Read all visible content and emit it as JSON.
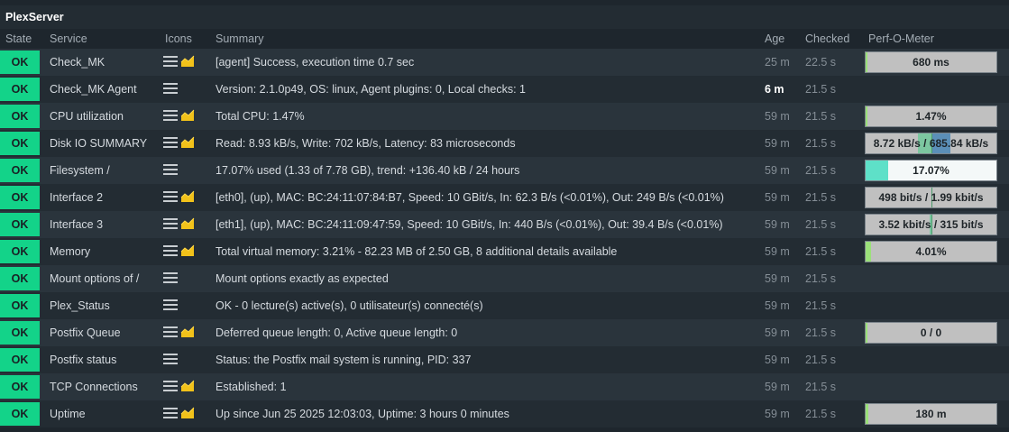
{
  "host": {
    "name": "PlexServer"
  },
  "columns": {
    "state": "State",
    "service": "Service",
    "icons": "Icons",
    "summary": "Summary",
    "age": "Age",
    "checked": "Checked",
    "perf": "Perf-O-Meter"
  },
  "colors": {
    "ok": "#13d389",
    "perf_green": "#9be07a",
    "perf_teal": "#5ee0c8",
    "perf_io_write": "#5b8fb8",
    "perf_io_read": "#7cc6a0"
  },
  "icons": {
    "menu": "hamburger-menu-icon",
    "graph": "graph-icon"
  },
  "rows": [
    {
      "state": "OK",
      "service": "Check_MK",
      "graph": true,
      "summary": "[agent] Success, execution time 0.7 sec",
      "age": "25 m",
      "age_recent": false,
      "checked": "22.5 s",
      "perf": {
        "label": "680 ms",
        "kind": "single",
        "level": 0.0
      }
    },
    {
      "state": "OK",
      "service": "Check_MK Agent",
      "graph": false,
      "summary": "Version: 2.1.0p49, OS: linux, Agent plugins: 0, Local checks: 1",
      "age": "6 m",
      "age_recent": true,
      "checked": "21.5 s",
      "perf": null
    },
    {
      "state": "OK",
      "service": "CPU utilization",
      "graph": true,
      "summary": "Total CPU: 1.47%",
      "age": "59 m",
      "age_recent": false,
      "checked": "21.5 s",
      "perf": {
        "label": "1.47%",
        "kind": "single",
        "level": 0.0147
      }
    },
    {
      "state": "OK",
      "service": "Disk IO SUMMARY",
      "graph": true,
      "summary": "Read: 8.93 kB/s, Write: 702 kB/s, Latency: 83 microseconds",
      "age": "59 m",
      "age_recent": false,
      "checked": "21.5 s",
      "perf": {
        "label": "8.72 kB/s / 685.84 kB/s",
        "kind": "dual",
        "left_level": 0.2,
        "right_level": 0.3
      }
    },
    {
      "state": "OK",
      "service": "Filesystem /",
      "graph": false,
      "summary": "17.07% used (1.33 of 7.78 GB), trend: +136.40 kB / 24 hours",
      "age": "59 m",
      "age_recent": false,
      "checked": "21.5 s",
      "perf": {
        "label": "17.07%",
        "kind": "fs",
        "level": 0.1707
      }
    },
    {
      "state": "OK",
      "service": "Interface 2",
      "graph": true,
      "summary": "[eth0], (up), MAC: BC:24:11:07:84:B7, Speed: 10 GBit/s, In: 62.3 B/s (<0.01%), Out: 249 B/s (<0.01%)",
      "age": "59 m",
      "age_recent": false,
      "checked": "21.5 s",
      "perf": {
        "label": "498 bit/s / 1.99 kbit/s",
        "kind": "dual",
        "left_level": 0.0,
        "right_level": 0.02
      }
    },
    {
      "state": "OK",
      "service": "Interface 3",
      "graph": true,
      "summary": "[eth1], (up), MAC: BC:24:11:09:47:59, Speed: 10 GBit/s, In: 440 B/s (<0.01%), Out: 39.4 B/s (<0.01%)",
      "age": "59 m",
      "age_recent": false,
      "checked": "21.5 s",
      "perf": {
        "label": "3.52 kbit/s / 315 bit/s",
        "kind": "dual",
        "left_level": 0.02,
        "right_level": 0.0
      }
    },
    {
      "state": "OK",
      "service": "Memory",
      "graph": true,
      "summary": "Total virtual memory: 3.21% - 82.23 MB of 2.50 GB, 8 additional details available",
      "age": "59 m",
      "age_recent": false,
      "checked": "21.5 s",
      "perf": {
        "label": "4.01%",
        "kind": "single",
        "level": 0.0401
      }
    },
    {
      "state": "OK",
      "service": "Mount options of /",
      "graph": false,
      "summary": "Mount options exactly as expected",
      "age": "59 m",
      "age_recent": false,
      "checked": "21.5 s",
      "perf": null
    },
    {
      "state": "OK",
      "service": "Plex_Status",
      "graph": false,
      "summary": "OK - 0 lecture(s) active(s), 0 utilisateur(s) connecté(s)",
      "age": "59 m",
      "age_recent": false,
      "checked": "21.5 s",
      "perf": null
    },
    {
      "state": "OK",
      "service": "Postfix Queue",
      "graph": true,
      "summary": "Deferred queue length: 0, Active queue length: 0",
      "age": "59 m",
      "age_recent": false,
      "checked": "21.5 s",
      "perf": {
        "label": "0 / 0",
        "kind": "single",
        "level": 0.0
      }
    },
    {
      "state": "OK",
      "service": "Postfix status",
      "graph": false,
      "summary": "Status: the Postfix mail system is running, PID: 337",
      "age": "59 m",
      "age_recent": false,
      "checked": "21.5 s",
      "perf": null
    },
    {
      "state": "OK",
      "service": "TCP Connections",
      "graph": true,
      "summary": "Established: 1",
      "age": "59 m",
      "age_recent": false,
      "checked": "21.5 s",
      "perf": null
    },
    {
      "state": "OK",
      "service": "Uptime",
      "graph": true,
      "summary": "Up since Jun 25 2025 12:03:03, Uptime: 3 hours 0 minutes",
      "age": "59 m",
      "age_recent": false,
      "checked": "21.5 s",
      "perf": {
        "label": "180 m",
        "kind": "single",
        "level": 0.02
      }
    }
  ]
}
